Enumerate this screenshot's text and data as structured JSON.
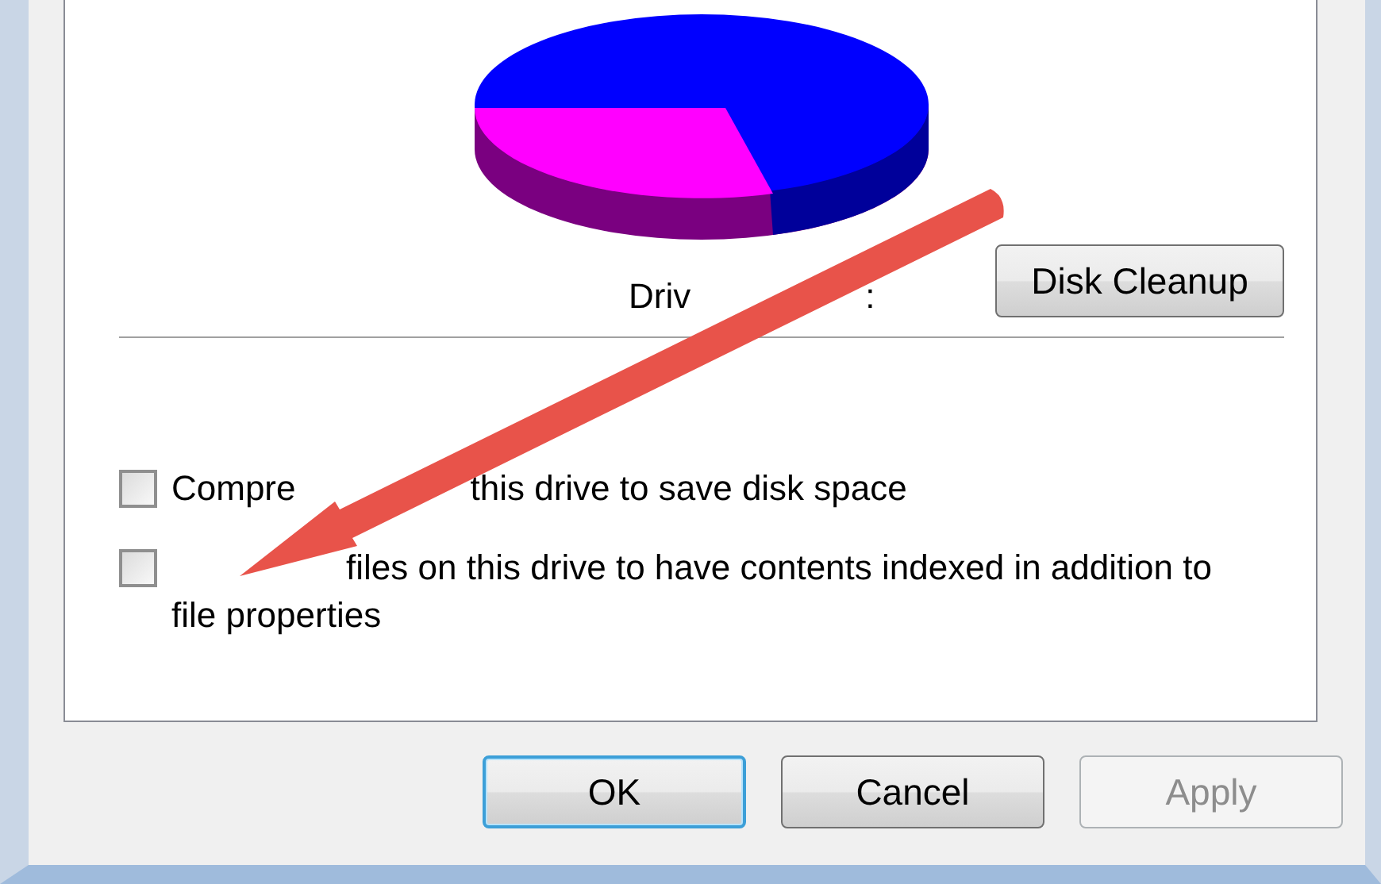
{
  "drive_label": [
    {
      "kind": "text",
      "text": "Driv"
    },
    {
      "kind": "covered"
    },
    {
      "kind": "text",
      "text": ":"
    }
  ],
  "disk_cleanup_button": "Disk Cleanup",
  "options": [
    {
      "checked": false,
      "lines": [
        [
          {
            "kind": "text",
            "text": "Compre"
          },
          {
            "kind": "covered"
          },
          {
            "kind": "text",
            "text": "this drive to save disk space"
          }
        ]
      ]
    },
    {
      "checked": false,
      "lines": [
        [
          {
            "kind": "covered"
          },
          {
            "kind": "text",
            "text": "files on this drive to have contents indexed in addition to"
          }
        ],
        [
          {
            "kind": "text",
            "text": "file properties"
          }
        ]
      ]
    }
  ],
  "buttons": [
    {
      "label": "OK",
      "default": true,
      "disabled": false
    },
    {
      "label": "Cancel",
      "default": false,
      "disabled": false
    },
    {
      "label": "Apply",
      "default": false,
      "disabled": true
    }
  ]
}
